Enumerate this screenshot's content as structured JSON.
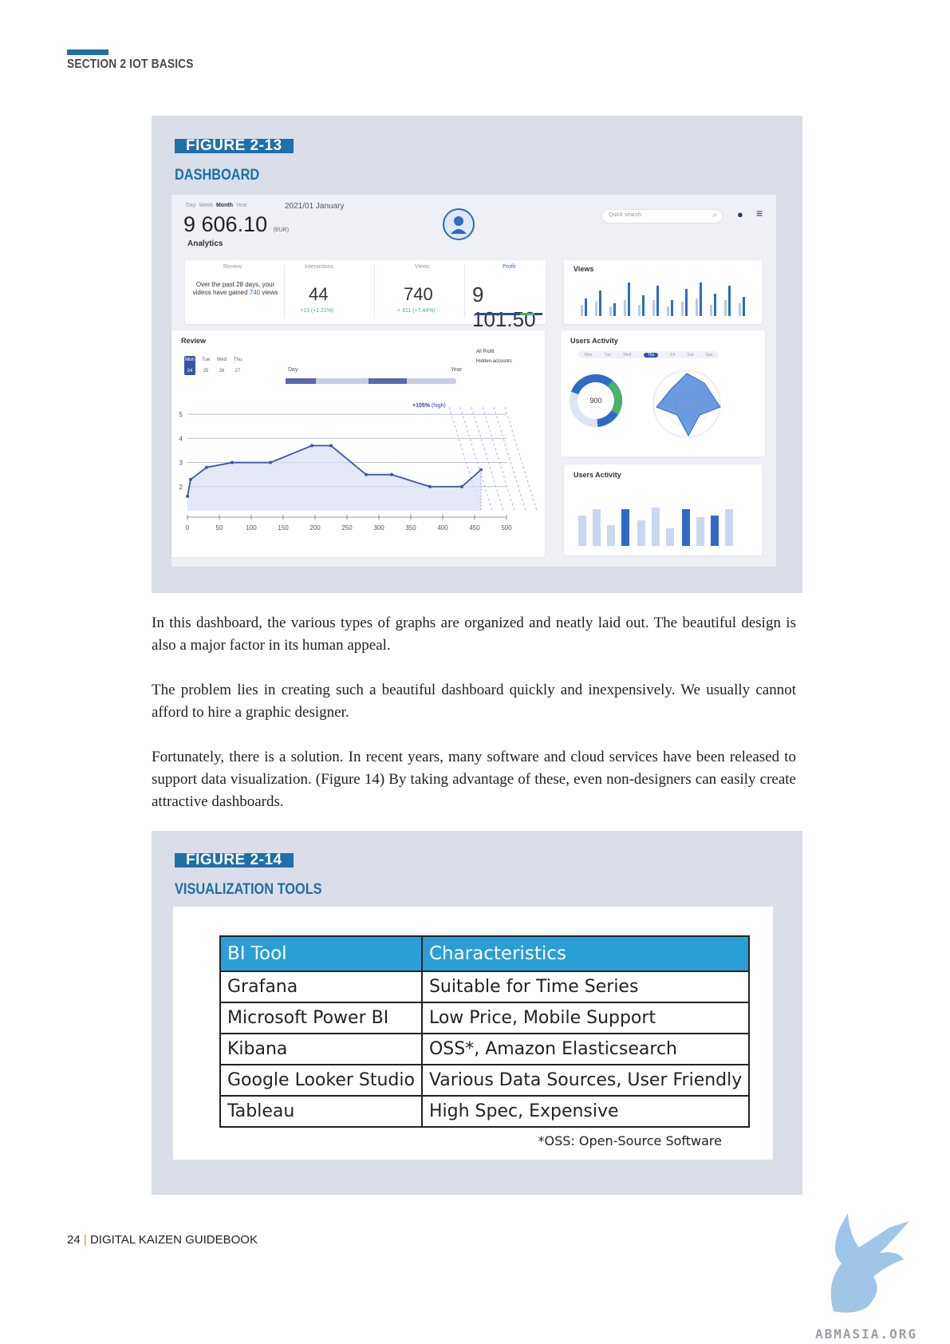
{
  "header": {
    "section": "SECTION 2  IOT BASICS"
  },
  "figure13": {
    "badge": "FIGURE 2-13",
    "title": "DASHBOARD",
    "dashboard": {
      "tabs": [
        "Day",
        "Week",
        "Month",
        "Year"
      ],
      "date": "2021/01  January",
      "total": "9 606.10",
      "currency": "(EUR)",
      "analytics": "Analytics",
      "search_placeholder": "Quick search",
      "stats": {
        "review_label": "Review",
        "review_text_a": "Over the past 28 days, your",
        "review_text_b": "videos have gained",
        "review_text_num": "740",
        "review_text_c": "views",
        "interactions_label": "Interactions",
        "interactions_value": "44",
        "interactions_change": "+13 (+1.21%)",
        "views_label": "Views",
        "views_value": "740",
        "views_change": "+ 311 (+7.44%)",
        "profit_label": "Profit",
        "profit_value": "9 101.50"
      },
      "views_panel_title": "Views",
      "review_panel": {
        "title": "Review",
        "days": [
          "Mon",
          "Tue",
          "Wed",
          "Thu"
        ],
        "dates": [
          "24",
          "25",
          "26",
          "27"
        ],
        "all_profit": "All Profit",
        "hidden_accounts": "Hidden accounts",
        "day_label": "Day",
        "year_label": "Year",
        "badge": "+105%",
        "badge_sub": "(high)"
      },
      "users_activity_title": "Users Activity",
      "users_activity_days": [
        "Mon",
        "Tue",
        "Wed",
        "Thu",
        "Fri",
        "Sat",
        "Sun"
      ],
      "donut_value": "900",
      "users_activity2_title": "Users Activity"
    },
    "chart_data": {
      "type": "line",
      "x": [
        0,
        5,
        30,
        70,
        130,
        195,
        225,
        280,
        320,
        380,
        430,
        460
      ],
      "y": [
        1.6,
        2.3,
        2.8,
        3.0,
        3.0,
        3.7,
        3.7,
        2.5,
        2.5,
        2.0,
        2.0,
        2.7
      ],
      "xticks": [
        "0",
        "50",
        "100",
        "150",
        "200",
        "250",
        "300",
        "350",
        "400",
        "450",
        "500"
      ],
      "yticks": [
        "2",
        "3",
        "4",
        "5"
      ],
      "xlim": [
        0,
        500
      ],
      "ylim": [
        1,
        5.5
      ]
    }
  },
  "paragraphs": [
    "In this dashboard, the various types of graphs are organized and neatly laid out. The beautiful design is also a major factor in its human appeal.",
    "The problem lies in creating such a beautiful dashboard quickly and inexpensively. We usually cannot afford to hire a graphic designer.",
    "Fortunately, there is a solution. In recent years, many software and cloud services have been released to support data visualization. (Figure 14) By taking advantage of these, even non-designers can easily create attractive dashboards."
  ],
  "figure14": {
    "badge": "FIGURE 2-14",
    "title": "VISUALIZATION TOOLS",
    "table": {
      "headers": [
        "BI Tool",
        "Characteristics"
      ],
      "rows": [
        [
          "Grafana",
          "Suitable for Time Series"
        ],
        [
          "Microsoft Power BI",
          "Low Price, Mobile Support"
        ],
        [
          "Kibana",
          "OSS*, Amazon Elasticsearch"
        ],
        [
          "Google Looker Studio",
          "Various Data Sources, User Friendly"
        ],
        [
          "Tableau",
          "High Spec, Expensive"
        ]
      ],
      "note": "*OSS: Open-Source Software"
    }
  },
  "footer": {
    "page": "24",
    "title": "DIGITAL KAIZEN GUIDEBOOK"
  },
  "watermark": {
    "text": "ABMASIA.ORG"
  },
  "colors": {
    "brand": "#1f6fa8",
    "table_header": "#2a9fd6"
  }
}
